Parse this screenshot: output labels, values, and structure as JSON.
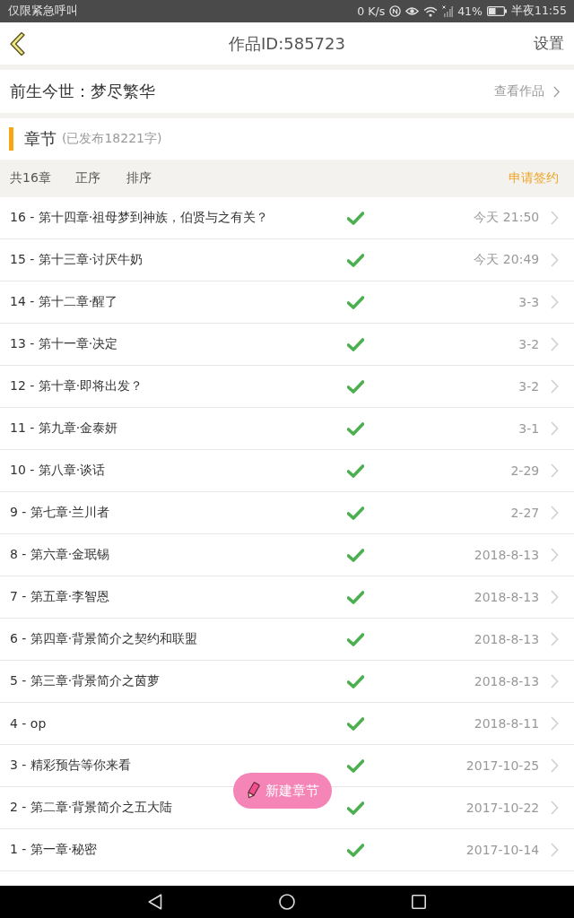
{
  "status_bar": {
    "carrier": "仅限紧急呼叫",
    "speed": "0 K/s",
    "battery": "41%",
    "time": "半夜11:55"
  },
  "header": {
    "title": "作品ID:585723",
    "action": "设置"
  },
  "work": {
    "title": "前生今世：梦尽繁华",
    "link": "查看作品"
  },
  "section": {
    "title": "章节",
    "subtitle": "(已发布18221字)"
  },
  "toolbar": {
    "count": "共16章",
    "order": "正序",
    "sort": "排序",
    "apply": "申请签约"
  },
  "chapters": [
    {
      "title": "16 - 第十四章·祖母梦到神族，伯贤与之有关？",
      "published": true,
      "date": "今天 21:50"
    },
    {
      "title": "15 - 第十三章·讨厌牛奶",
      "published": true,
      "date": "今天 20:49"
    },
    {
      "title": "14 - 第十二章·醒了",
      "published": true,
      "date": "3-3"
    },
    {
      "title": "13 - 第十一章·决定",
      "published": true,
      "date": "3-2"
    },
    {
      "title": "12 - 第十章·即将出发？",
      "published": true,
      "date": "3-2"
    },
    {
      "title": "11 - 第九章·金泰妍",
      "published": true,
      "date": "3-1"
    },
    {
      "title": "10 - 第八章·谈话",
      "published": true,
      "date": "2-29"
    },
    {
      "title": "9 - 第七章·兰川者",
      "published": true,
      "date": "2-27"
    },
    {
      "title": "8 - 第六章·金珉锡",
      "published": true,
      "date": "2018-8-13"
    },
    {
      "title": "7 - 第五章·李智恩",
      "published": true,
      "date": "2018-8-13"
    },
    {
      "title": "6 - 第四章·背景简介之契约和联盟",
      "published": true,
      "date": "2018-8-13"
    },
    {
      "title": "5 - 第三章·背景简介之茵萝",
      "published": true,
      "date": "2018-8-13"
    },
    {
      "title": "4 - op",
      "published": true,
      "date": "2018-8-11"
    },
    {
      "title": "3 - 精彩预告等你来看",
      "published": true,
      "date": "2017-10-25"
    },
    {
      "title": "2 - 第二章·背景简介之五大陆",
      "published": true,
      "date": "2017-10-22"
    },
    {
      "title": "1 - 第一章·秘密",
      "published": true,
      "date": "2017-10-14"
    }
  ],
  "fab": {
    "label": "新建章节"
  }
}
